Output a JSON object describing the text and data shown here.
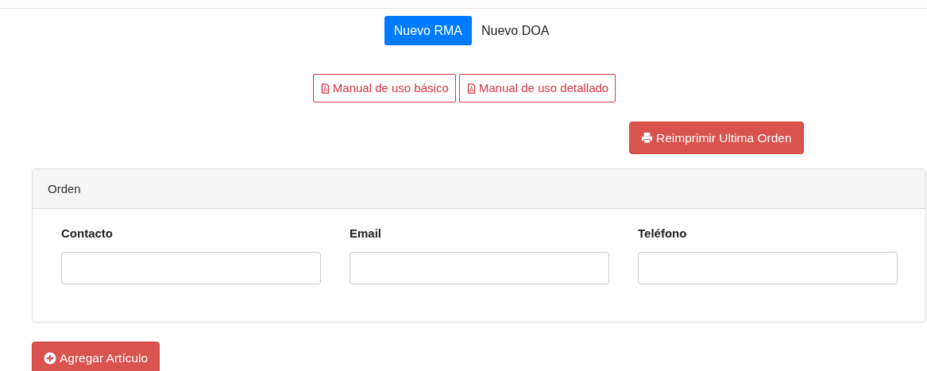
{
  "tabs": [
    {
      "label": "Nuevo RMA",
      "selected": true
    },
    {
      "label": "Nuevo DOA",
      "selected": false
    }
  ],
  "manuals": [
    "Manual de uso básico",
    "Manual de uso detallado"
  ],
  "reprint_button": "Reimprimir Ultima Orden",
  "order_card": {
    "title": "Orden",
    "fields": [
      {
        "label": "Contacto"
      },
      {
        "label": "Email"
      },
      {
        "label": "Teléfono"
      }
    ]
  },
  "add_button": "Agregar Artículo"
}
